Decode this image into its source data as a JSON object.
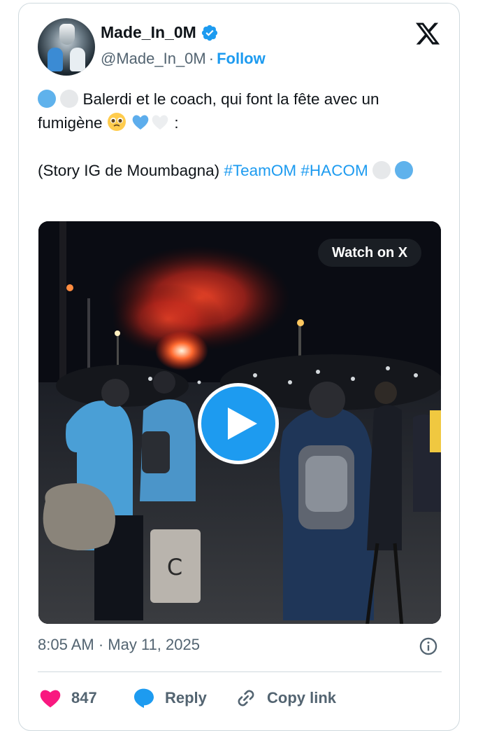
{
  "user": {
    "display_name": "Made_In_0M",
    "handle": "@Made_In_0M",
    "separator": "·",
    "follow_label": "Follow",
    "verified_color": "#1d9bf0"
  },
  "tweet": {
    "line1_text": " Balerdi et le coach, qui font la fête avec un fumigène ",
    "line1_suffix": " :",
    "line2_text": "(Story IG de Moumbagna) ",
    "hashtags": [
      "#TeamOM",
      "#HACOM"
    ],
    "emoji": [
      "blue-circle",
      "white-circle",
      "pleading-face",
      "blue-heart",
      "white-heart"
    ]
  },
  "media": {
    "watch_label": "Watch on X",
    "play_icon": "play-icon"
  },
  "meta": {
    "time": "8:05 AM",
    "separator": "·",
    "date": "May 11, 2025"
  },
  "actions": {
    "like_count": "847",
    "reply_label": "Reply",
    "copy_label": "Copy link"
  },
  "colors": {
    "accent": "#1d9bf0",
    "text": "#0f1419",
    "secondary": "#536471",
    "like": "#f91880",
    "om_blue": "#5fb2ec"
  }
}
